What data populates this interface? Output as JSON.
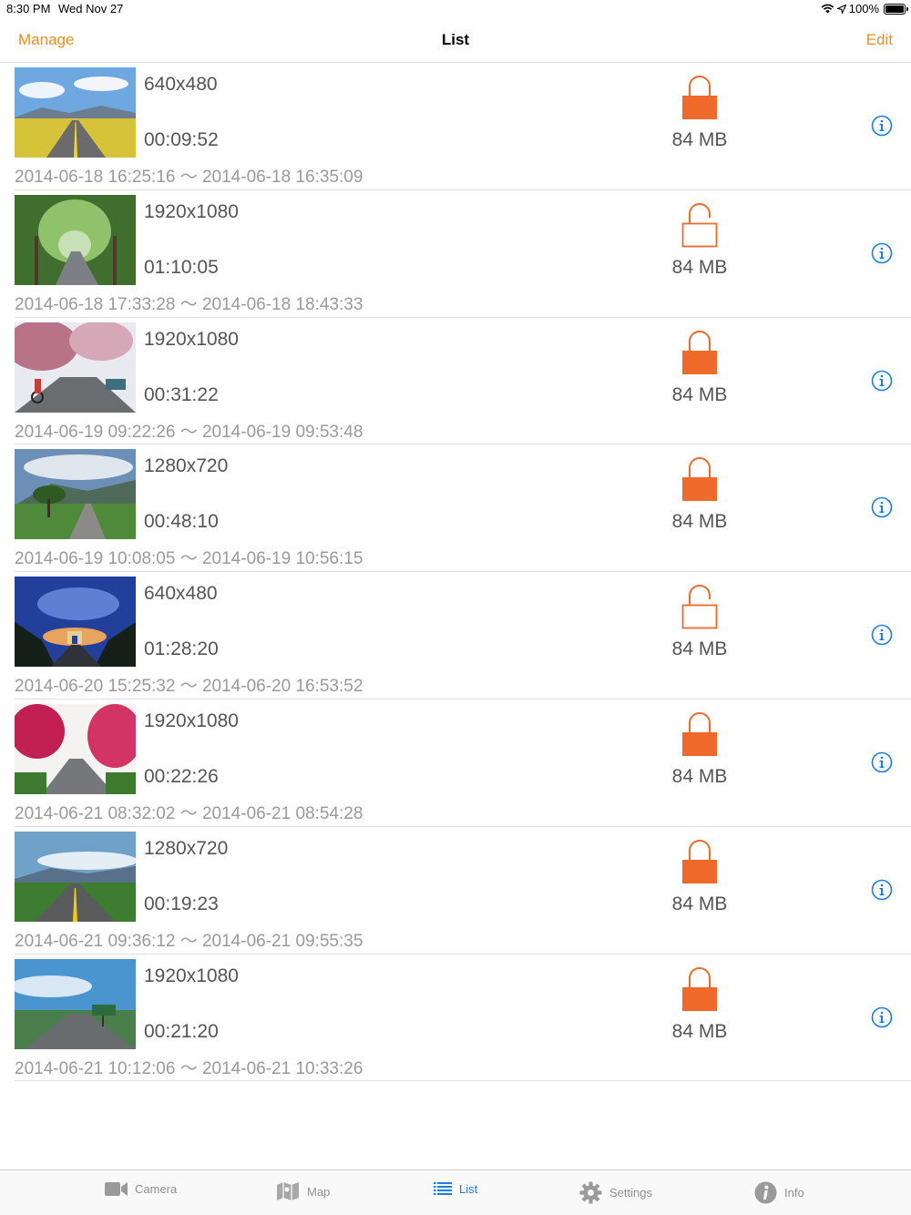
{
  "status": {
    "time": "8:30 PM",
    "date": "Wed Nov 27",
    "battery": "100%"
  },
  "nav": {
    "left": "Manage",
    "title": "List",
    "right": "Edit"
  },
  "colors": {
    "accent": "#f08c1c",
    "lock": "#ef6a2a",
    "info": "#1a7de6"
  },
  "rows": [
    {
      "resolution": "640x480",
      "duration": "00:09:52",
      "size": "84 MB",
      "locked": true,
      "range": "2014-06-18 16:25:16 〜 2014-06-18 16:35:09",
      "thumb": "road-field"
    },
    {
      "resolution": "1920x1080",
      "duration": "01:10:05",
      "size": "84 MB",
      "locked": false,
      "range": "2014-06-18 17:33:28 〜 2014-06-18 18:43:33",
      "thumb": "tree-tunnel"
    },
    {
      "resolution": "1920x1080",
      "duration": "00:31:22",
      "size": "84 MB",
      "locked": true,
      "range": "2014-06-19 09:22:26 〜 2014-06-19 09:53:48",
      "thumb": "blossom-cyclist"
    },
    {
      "resolution": "1280x720",
      "duration": "00:48:10",
      "size": "84 MB",
      "locked": true,
      "range": "2014-06-19 10:08:05 〜 2014-06-19 10:56:15",
      "thumb": "single-tree"
    },
    {
      "resolution": "640x480",
      "duration": "01:28:20",
      "size": "84 MB",
      "locked": false,
      "range": "2014-06-20 15:25:32 〜 2014-06-20 16:53:52",
      "thumb": "arch-dusk"
    },
    {
      "resolution": "1920x1080",
      "duration": "00:22:26",
      "size": "84 MB",
      "locked": true,
      "range": "2014-06-21 08:32:02 〜 2014-06-21 08:54:28",
      "thumb": "pink-blossom"
    },
    {
      "resolution": "1280x720",
      "duration": "00:19:23",
      "size": "84 MB",
      "locked": true,
      "range": "2014-06-21 09:36:12 〜 2014-06-21 09:55:35",
      "thumb": "road-yellow-line"
    },
    {
      "resolution": "1920x1080",
      "duration": "00:21:20",
      "size": "84 MB",
      "locked": true,
      "range": "2014-06-21 10:12:06 〜 2014-06-21 10:33:26",
      "thumb": "highway"
    }
  ],
  "tabs": [
    {
      "label": "Camera",
      "icon": "camera-icon",
      "active": false
    },
    {
      "label": "Map",
      "icon": "map-icon",
      "active": false
    },
    {
      "label": "List",
      "icon": "list-icon",
      "active": true
    },
    {
      "label": "Settings",
      "icon": "gear-icon",
      "active": false
    },
    {
      "label": "Info",
      "icon": "info-icon",
      "active": false
    }
  ]
}
